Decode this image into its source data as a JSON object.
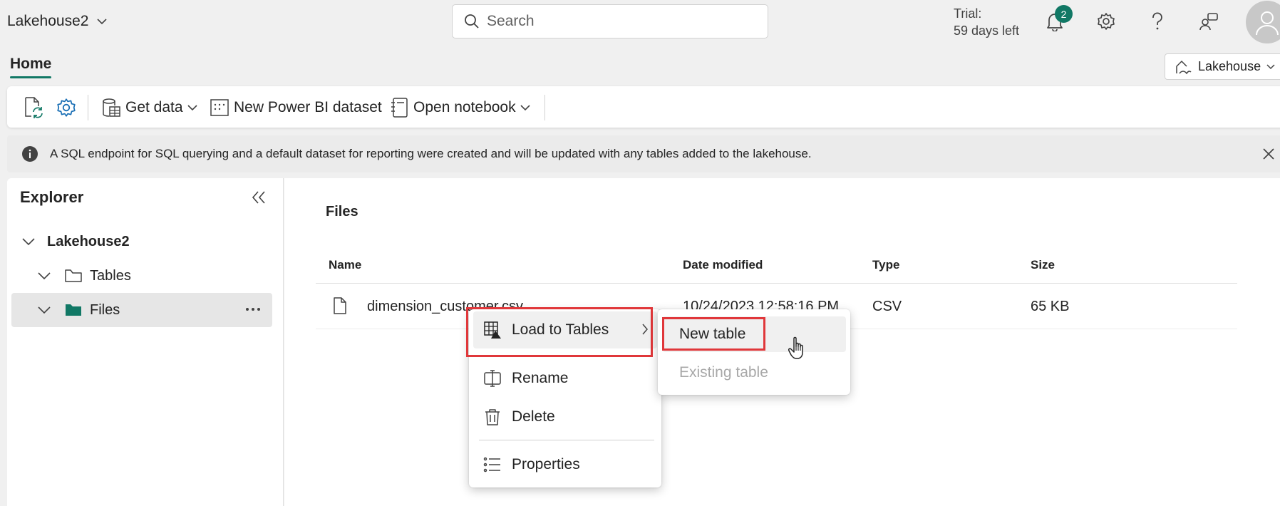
{
  "header": {
    "workspace_title": "Lakehouse2",
    "search_placeholder": "Search",
    "trial_line1": "Trial:",
    "trial_line2": "59 days left",
    "notification_count": "2"
  },
  "tabs": {
    "home": "Home"
  },
  "experience_switcher": {
    "label": "Lakehouse"
  },
  "ribbon": {
    "get_data": "Get data",
    "new_dataset": "New Power BI dataset",
    "open_notebook": "Open notebook"
  },
  "info_bar": {
    "message": "A SQL endpoint for SQL querying and a default dataset for reporting were created and will be updated with any tables added to the lakehouse."
  },
  "explorer": {
    "title": "Explorer",
    "root": "Lakehouse2",
    "items": [
      {
        "label": "Tables"
      },
      {
        "label": "Files"
      }
    ]
  },
  "files_view": {
    "title": "Files",
    "columns": [
      "Name",
      "Date modified",
      "Type",
      "Size"
    ],
    "rows": [
      {
        "name": "dimension_customer.csv",
        "name_visible": "dimension_cust",
        "name_tail": "omer.csv",
        "date": "10/24/2023 12:58:16 PM",
        "type": "CSV",
        "size": "65 KB"
      }
    ]
  },
  "context_menu": {
    "load_to_tables": "Load to Tables",
    "rename": "Rename",
    "delete": "Delete",
    "properties": "Properties"
  },
  "submenu": {
    "new_table": "New table",
    "existing_table": "Existing table"
  },
  "colors": {
    "accent": "#117865",
    "highlight_border": "#e0373a",
    "disabled_text": "#a8a8a8"
  }
}
